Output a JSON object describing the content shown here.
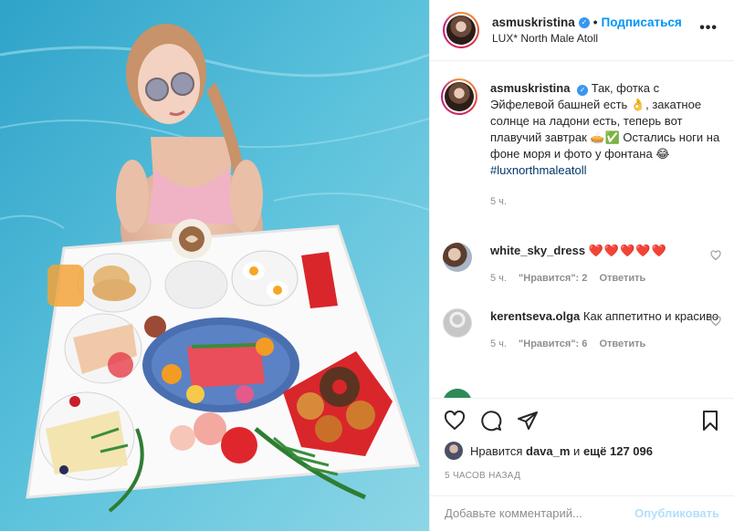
{
  "post": {
    "username": "asmuskristina",
    "follow_label": "Подписаться",
    "location": "LUX* North Male Atoll",
    "more_label": "•••",
    "dot": "•",
    "verified_mark": "✓"
  },
  "caption": {
    "username": "asmuskristina",
    "text": "Так, фотка с Эйфелевой башней есть 👌, закатное солнце на ладони есть, теперь вот плавучий завтрак 🥧✅ Остались ноги на фоне моря и фото у фонтана 😂",
    "hashtag": "#luxnorthmaleatoll",
    "time": "5 ч."
  },
  "comments": [
    {
      "username": "white_sky_dress",
      "text": "❤️❤️❤️❤️❤️",
      "time": "5 ч.",
      "likes": "\"Нравится\": 2",
      "reply": "Ответить"
    },
    {
      "username": "kerentseva.olga",
      "text": "Как аппетитно и красиво",
      "time": "5 ч.",
      "likes": "\"Нравится\": 6",
      "reply": "Ответить"
    }
  ],
  "footer": {
    "likes_prefix": "Нравится",
    "likes_user": "dava_m",
    "likes_middle": "и",
    "likes_rest": "ещё 127 096",
    "time": "5 ЧАСОВ НАЗАД",
    "comment_placeholder": "Добавьте комментарий...",
    "publish_label": "Опубликовать"
  },
  "icons": {
    "like": "heart-icon",
    "comment": "comment-icon",
    "share": "paper-plane-icon",
    "save": "bookmark-icon"
  },
  "colors": {
    "link": "#0095f6",
    "hashtag": "#00376b",
    "muted": "#8e8e8e",
    "publish_disabled": "#b2dffc",
    "pool": "#4fb7d4"
  }
}
